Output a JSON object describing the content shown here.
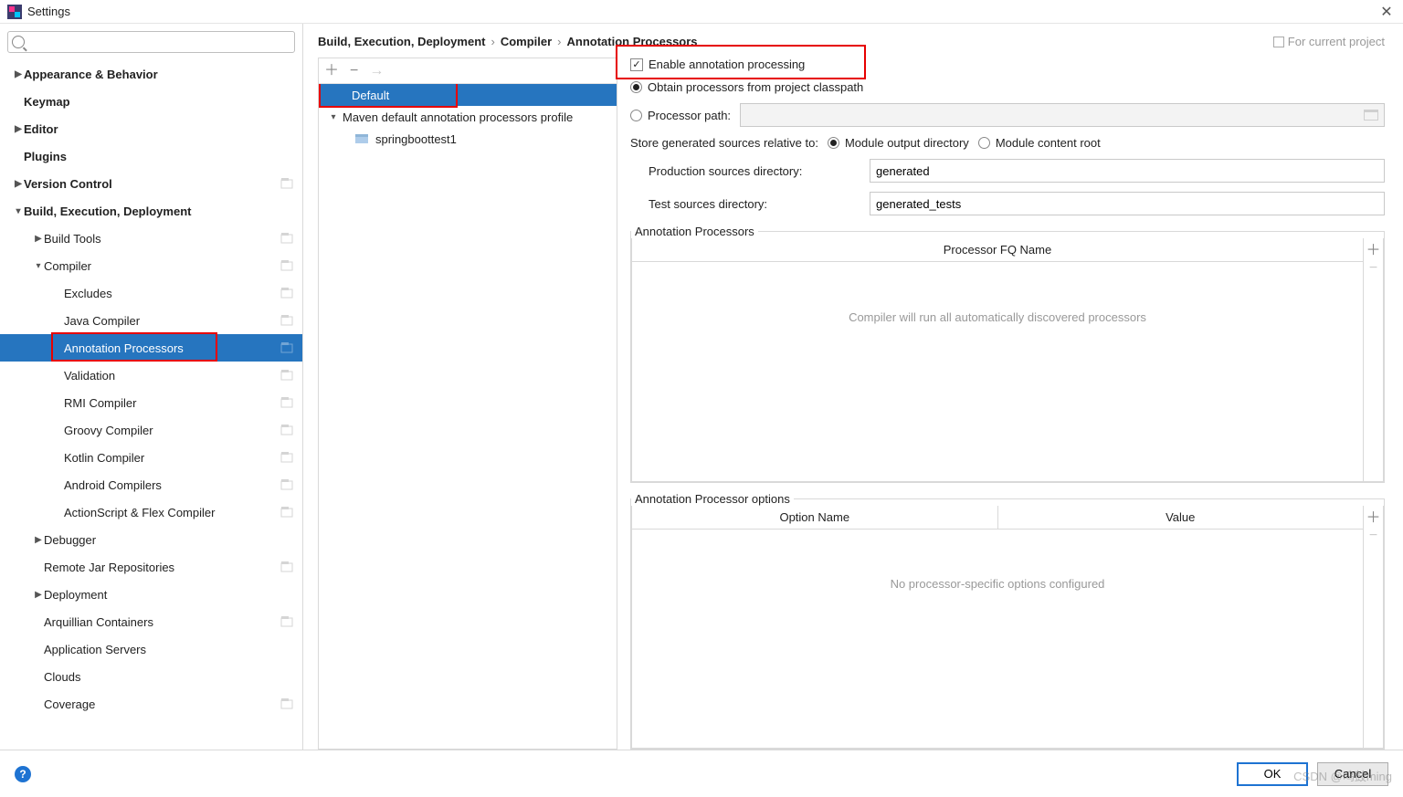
{
  "title": "Settings",
  "search_placeholder": "",
  "sidebar": [
    {
      "label": "Appearance & Behavior",
      "level": 0,
      "chev": "▶",
      "bold": true
    },
    {
      "label": "Keymap",
      "level": 0,
      "chev": "",
      "bold": true
    },
    {
      "label": "Editor",
      "level": 0,
      "chev": "▶",
      "bold": true
    },
    {
      "label": "Plugins",
      "level": 0,
      "chev": "",
      "bold": true
    },
    {
      "label": "Version Control",
      "level": 0,
      "chev": "▶",
      "bold": true,
      "badge": true
    },
    {
      "label": "Build, Execution, Deployment",
      "level": 0,
      "chev": "▾",
      "bold": true
    },
    {
      "label": "Build Tools",
      "level": 1,
      "chev": "▶",
      "badge": true
    },
    {
      "label": "Compiler",
      "level": 1,
      "chev": "▾",
      "badge": true
    },
    {
      "label": "Excludes",
      "level": 2,
      "badge": true
    },
    {
      "label": "Java Compiler",
      "level": 2,
      "badge": true
    },
    {
      "label": "Annotation Processors",
      "level": 2,
      "badge": true,
      "selected": true,
      "redbox": true
    },
    {
      "label": "Validation",
      "level": 2,
      "badge": true
    },
    {
      "label": "RMI Compiler",
      "level": 2,
      "badge": true
    },
    {
      "label": "Groovy Compiler",
      "level": 2,
      "badge": true
    },
    {
      "label": "Kotlin Compiler",
      "level": 2,
      "badge": true
    },
    {
      "label": "Android Compilers",
      "level": 2,
      "badge": true
    },
    {
      "label": "ActionScript & Flex Compiler",
      "level": 2,
      "badge": true
    },
    {
      "label": "Debugger",
      "level": 1,
      "chev": "▶"
    },
    {
      "label": "Remote Jar Repositories",
      "level": 1,
      "badge": true
    },
    {
      "label": "Deployment",
      "level": 1,
      "chev": "▶"
    },
    {
      "label": "Arquillian Containers",
      "level": 1,
      "badge": true
    },
    {
      "label": "Application Servers",
      "level": 1
    },
    {
      "label": "Clouds",
      "level": 1
    },
    {
      "label": "Coverage",
      "level": 1,
      "badge": true
    }
  ],
  "breadcrumb": [
    "Build, Execution, Deployment",
    "Compiler",
    "Annotation Processors"
  ],
  "scope_text": "For current project",
  "profiles": [
    {
      "label": "Default",
      "depth": 0,
      "selected": true,
      "redbox": true
    },
    {
      "label": "Maven default annotation processors profile",
      "depth": 1,
      "chev": "▾"
    },
    {
      "label": "springboottest1",
      "depth": 2,
      "icon": true
    }
  ],
  "enable_label": "Enable annotation processing",
  "obtain_label": "Obtain processors from project classpath",
  "processor_path_label": "Processor path:",
  "store_label": "Store generated sources relative to:",
  "module_output_label": "Module output directory",
  "module_content_label": "Module content root",
  "prod_label": "Production sources directory:",
  "prod_value": "generated",
  "test_label": "Test sources directory:",
  "test_value": "generated_tests",
  "proc_legend": "Annotation Processors",
  "proc_header": "Processor FQ Name",
  "proc_empty": "Compiler will run all automatically discovered processors",
  "opts_legend": "Annotation Processor options",
  "opts_h1": "Option Name",
  "opts_h2": "Value",
  "opts_empty": "No processor-specific options configured",
  "ok": "OK",
  "cancel": "Cancel",
  "watermark": "CSDN @呜鼓ming"
}
